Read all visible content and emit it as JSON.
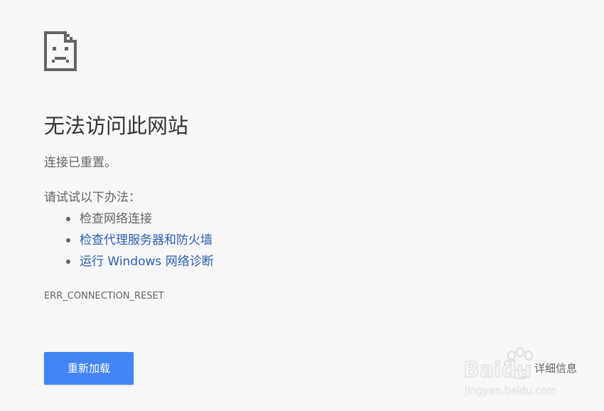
{
  "window": {
    "background": "#f7f7f7"
  },
  "error": {
    "icon": "sad-page-icon",
    "title": "无法访问此网站",
    "message": "连接已重置。",
    "suggestions_heading": "请试试以下办法：",
    "suggestions": [
      {
        "label": "检查网络连接",
        "link": false
      },
      {
        "label": "检查代理服务器和防火墙",
        "link": true
      },
      {
        "label": "运行 Windows 网络诊断",
        "link": true
      }
    ],
    "code": "ERR_CONNECTION_RESET"
  },
  "buttons": {
    "reload_label": "重新加载",
    "details_label": "详细信息"
  },
  "colors": {
    "accent": "#4285f4",
    "link": "#2a5db0",
    "text": "#646464",
    "title": "#333333"
  },
  "watermark": {
    "text": "Baidu",
    "subtext": "jingyan.baidu.com"
  }
}
